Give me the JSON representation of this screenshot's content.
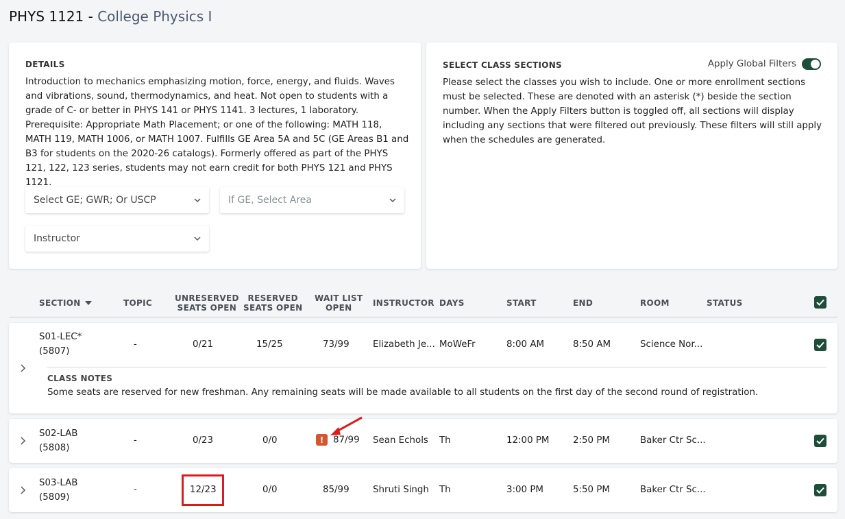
{
  "page": {
    "course_code": "PHYS 1121",
    "separator": " - ",
    "course_name": "College Physics I"
  },
  "details": {
    "heading": "DETAILS",
    "description": "Introduction to mechanics emphasizing motion, force, energy, and fluids. Waves and vibrations, sound, thermodynamics, and heat. Not open to students with a grade of C- or better in PHYS 141 or PHYS 1141. 3 lectures, 1 laboratory. Prerequisite: Appropriate Math Placement; or one of the following: MATH 118, MATH 119, MATH 1006, or MATH 1007. Fulfills GE Area 5A and 5C (GE Areas B1 and B3 for students on the 2020-26 catalogs). Formerly offered as part of the PHYS 121, 122, 123 series, students may not earn credit for both PHYS 121 and PHYS 1121.",
    "select_ge": "Select GE; GWR; Or USCP",
    "select_area_placeholder": "If GE, Select Area",
    "select_instructor": "Instructor"
  },
  "class_sections": {
    "heading": "SELECT CLASS SECTIONS",
    "toggle_label": "Apply Global Filters",
    "toggle_on": true,
    "description": "Please select the classes you wish to include. One or more enrollment sections must be selected. These are denoted with an asterisk (*) beside the section number. When the Apply Filters button is toggled off, all sections will display including any sections that were filtered out previously. These filters will still apply when the schedules are generated."
  },
  "table": {
    "headers": {
      "section": "SECTION",
      "topic": "TOPIC",
      "unreserved_1": "UNRESERVED",
      "unreserved_2": "SEATS OPEN",
      "reserved_1": "RESERVED",
      "reserved_2": "SEATS OPEN",
      "waitlist_1": "WAIT LIST",
      "waitlist_2": "OPEN",
      "instructor": "INSTRUCTOR",
      "days": "DAYS",
      "start": "START",
      "end": "END",
      "room": "ROOM",
      "status": "STATUS"
    },
    "rows": [
      {
        "section": "S01-LEC*",
        "class_no": "(5807)",
        "topic": "-",
        "unreserved": "0/21",
        "reserved": "15/25",
        "waitlist": "73/99",
        "instructor": "Elizabeth Je...",
        "days": "MoWeFr",
        "start": "8:00 AM",
        "end": "8:50 AM",
        "room": "Science Nor...",
        "status": ""
      },
      {
        "section": "S02-LAB",
        "class_no": "(5808)",
        "topic": "-",
        "unreserved": "0/23",
        "reserved": "0/0",
        "waitlist": "87/99",
        "instructor": "Sean Echols",
        "days": "Th",
        "start": "12:00 PM",
        "end": "2:50 PM",
        "room": "Baker Ctr Sc...",
        "status": ""
      },
      {
        "section": "S03-LAB",
        "class_no": "(5809)",
        "topic": "-",
        "unreserved": "12/23",
        "reserved": "0/0",
        "waitlist": "85/99",
        "instructor": "Shruti Singh",
        "days": "Th",
        "start": "3:00 PM",
        "end": "5:50 PM",
        "room": "Baker Ctr Sc...",
        "status": ""
      }
    ],
    "class_notes": {
      "heading": "CLASS NOTES",
      "text": "Some seats are reserved for new freshman. Any remaining seats will be made available to all students on the first day of the second round of registration."
    },
    "warning_glyph": "!"
  },
  "colors": {
    "accent": "#1e4d3a",
    "warning": "#d9532c",
    "annotation": "#d91d1d"
  }
}
